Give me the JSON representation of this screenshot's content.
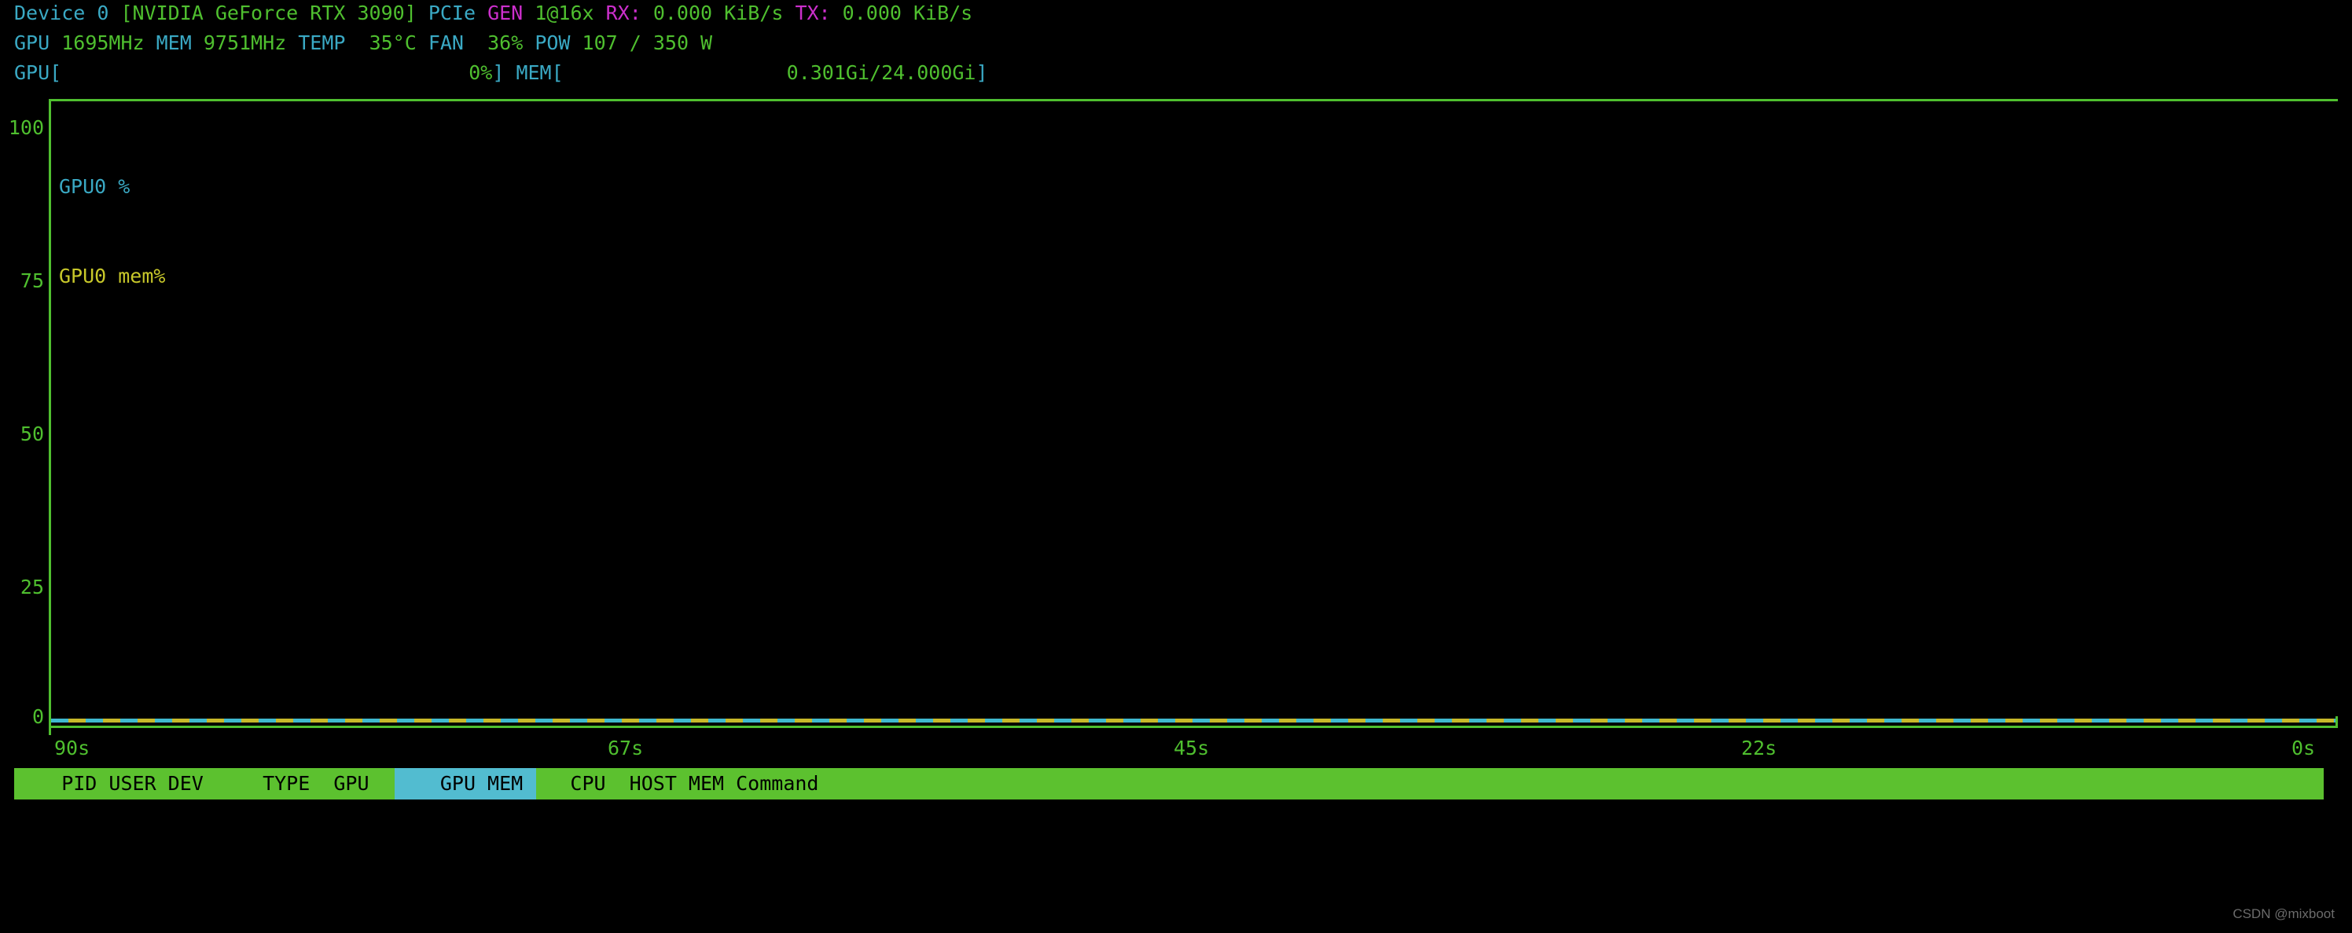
{
  "window": {
    "title": "nvtop",
    "background": "#000000"
  },
  "colors": {
    "green": "#4fbf2f",
    "cyan": "#3aa9c4",
    "magenta": "#cc2fcc",
    "bar_green": "#5cc12f",
    "bar_cyan": "#52bcd0",
    "legend_gpu": "#3aa9c4",
    "legend_mem": "#c8c82a",
    "watermark": "#6b6b6b"
  },
  "header": {
    "line1": {
      "device_label": "Device 0 ",
      "device_name": "[NVIDIA GeForce RTX 3090]",
      "pcie_label": " PCIe ",
      "gen_label": "GEN ",
      "gen_value": "1@16x ",
      "rx_label": "RX: ",
      "rx_value": "0.000 KiB/s ",
      "tx_label": "TX: ",
      "tx_value": "0.000 KiB/s"
    },
    "line2": {
      "gpu_label": "GPU ",
      "gpu_clock": "1695MHz",
      "mem_label": " MEM ",
      "mem_clock": "9751MHz",
      "temp_label": " TEMP ",
      "temp_value": " 35°C",
      "fan_label": " FAN ",
      "fan_value": " 36%",
      "pow_label": " POW ",
      "pow_value": "107 / 350 W"
    },
    "line3": {
      "gpu_bracket_open": "GPU[",
      "gpu_fill": "",
      "gpu_pct": "0%",
      "gpu_bracket_close": "]",
      "mem_bracket_open": " MEM[",
      "mem_fill": "",
      "mem_value": "0.301Gi/24.000Gi",
      "mem_bracket_close": "]"
    }
  },
  "legend": {
    "gpu_util": "GPU0 %",
    "gpu_mem": "GPU0 mem%"
  },
  "chart_data": {
    "type": "line",
    "title": "",
    "xlabel": "",
    "ylabel": "",
    "ylim": [
      0,
      100
    ],
    "yticks": [
      100,
      75,
      50,
      25,
      0
    ],
    "ytick_labels": [
      "100",
      "75",
      "50",
      "25",
      "0"
    ],
    "xticks": [
      "90s",
      "67s",
      "45s",
      "22s",
      "0s"
    ],
    "xtick_positions_pct": [
      0,
      25.5,
      51.0,
      76.2,
      100
    ],
    "grid": false,
    "legend_position": "top-left",
    "series": [
      {
        "name": "GPU0 %",
        "color": "#3aa9c4",
        "values": [
          0,
          0,
          0,
          0,
          0,
          0,
          0,
          0,
          0,
          0,
          0,
          0,
          0,
          0,
          0,
          0,
          0,
          0,
          0,
          0,
          0,
          0,
          0,
          0,
          0,
          0,
          0,
          0,
          0,
          0,
          0,
          0,
          0,
          0,
          0,
          0,
          0,
          0,
          0,
          0,
          0,
          0,
          0,
          0,
          0,
          0,
          0,
          0,
          0,
          0,
          0,
          0,
          0,
          0,
          0,
          0,
          0,
          0,
          0,
          0,
          0,
          0,
          0,
          0,
          0,
          0,
          0,
          0,
          0,
          0,
          0,
          0,
          0,
          0,
          0,
          0,
          0,
          0,
          0,
          0,
          0,
          0,
          0,
          0,
          0,
          0,
          0,
          0,
          0,
          0
        ]
      },
      {
        "name": "GPU0 mem%",
        "color": "#c8c82a",
        "values": [
          0,
          0,
          0,
          0,
          0,
          0,
          0,
          0,
          0,
          0,
          0,
          0,
          0,
          0,
          0,
          0,
          0,
          0,
          0,
          0,
          0,
          0,
          0,
          0,
          0,
          0,
          0,
          0,
          0,
          0,
          0,
          0,
          0,
          0,
          0,
          0,
          0,
          0,
          0,
          0,
          0,
          0,
          0,
          0,
          0,
          0,
          0,
          0,
          0,
          0,
          0,
          0,
          0,
          0,
          0,
          0,
          0,
          0,
          0,
          0,
          0,
          0,
          0,
          0,
          0,
          0,
          0,
          0,
          0,
          0,
          0,
          0,
          0,
          0,
          0,
          0,
          0,
          0,
          0,
          0,
          0,
          0,
          0,
          0,
          0,
          0,
          0,
          0,
          0,
          0
        ]
      }
    ]
  },
  "process_table": {
    "sorted_column": "GPU MEM",
    "columns": [
      {
        "label": "PID",
        "highlighted": false
      },
      {
        "label": "USER",
        "highlighted": false
      },
      {
        "label": "DEV",
        "highlighted": false
      },
      {
        "label": "TYPE",
        "highlighted": false
      },
      {
        "label": "GPU",
        "highlighted": false
      },
      {
        "label": "GPU MEM",
        "highlighted": true
      },
      {
        "label": "CPU",
        "highlighted": false
      },
      {
        "label": "HOST MEM",
        "highlighted": false
      },
      {
        "label": "Command",
        "highlighted": false
      }
    ],
    "header_line": "    PID USER DEV     TYPE  GPU      GPU MEM    CPU  HOST MEM Command",
    "rows": []
  },
  "watermark": "CSDN @mixboot"
}
